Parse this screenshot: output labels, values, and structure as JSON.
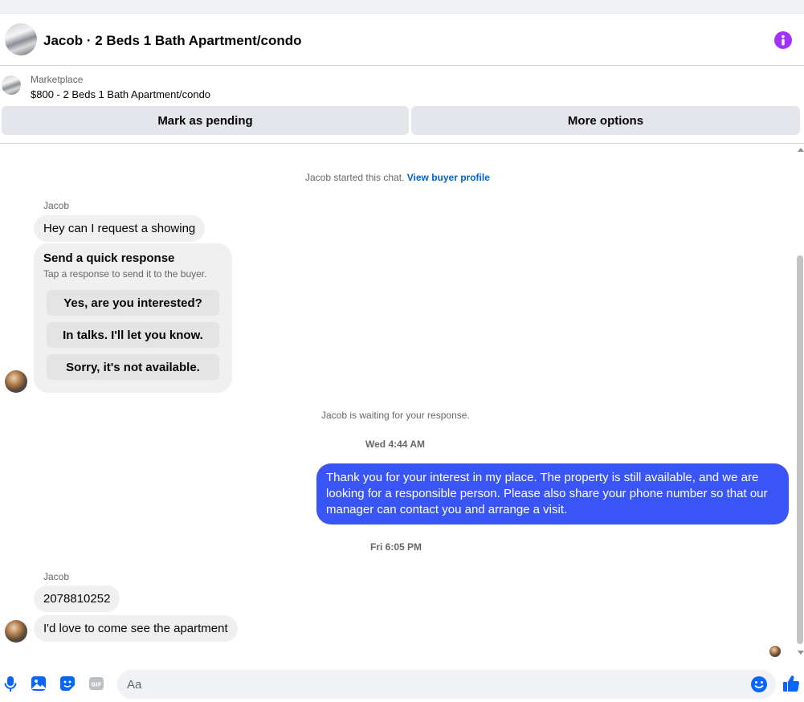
{
  "header": {
    "title": "Jacob · 2 Beds 1 Bath Apartment/condo"
  },
  "listing": {
    "source": "Marketplace",
    "price_title": "$800 - 2 Beds 1 Bath Apartment/condo",
    "pending_label": "Mark as pending",
    "more_label": "More options"
  },
  "thread": {
    "started_text": "Jacob started this chat.",
    "profile_link": "View buyer profile",
    "sender_name": "Jacob",
    "msg1": "Hey can I request a showing",
    "quick": {
      "title": "Send a quick response",
      "subtitle": "Tap a response to send it to the buyer.",
      "options": [
        "Yes, are you interested?",
        "In talks. I'll let you know.",
        "Sorry, it's not available."
      ]
    },
    "waiting_text": "Jacob is waiting for your response.",
    "stamp1": "Wed 4:44 AM",
    "reply": "Thank you for your interest in my place. The property is still available, and we are looking for a responsible person. Please also share your phone number so that our manager can contact you and arrange a visit.",
    "stamp2": "Fri 6:05 PM",
    "sender_name2": "Jacob",
    "msg2": "2078810252",
    "msg3": "I'd love to come see the apartment"
  },
  "composer": {
    "placeholder": "Aa",
    "icons": [
      "microphone-icon",
      "photo-icon",
      "sticker-icon",
      "gif-icon",
      "emoji-icon",
      "thumbs-up-icon"
    ]
  },
  "colors": {
    "accent": "#3a55f5",
    "info": "#a033ff",
    "icon_blue": "#0866ff"
  }
}
